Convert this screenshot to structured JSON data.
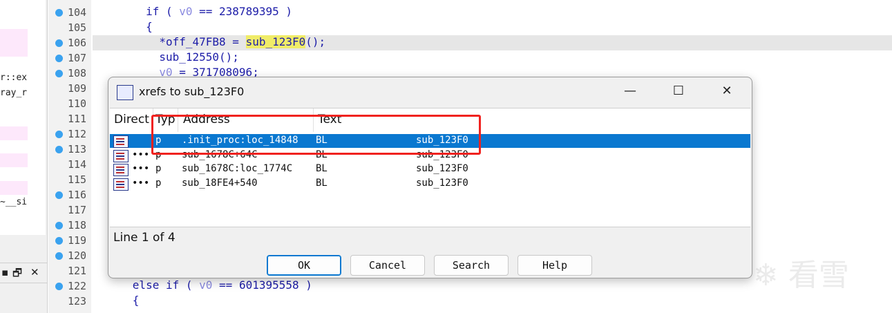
{
  "left_pane": {
    "text_1": "r::ex",
    "text_2": "ray_r",
    "text_3": "~__si"
  },
  "code": {
    "lines": [
      {
        "n": "104",
        "dot": true,
        "html": "        <span class='tok-kw'>if</span> ( <span class='tok-var'>v0</span> == 238789395 )"
      },
      {
        "n": "105",
        "dot": false,
        "html": "        {"
      },
      {
        "n": "106",
        "dot": true,
        "hl": true,
        "html": "          *off_47FB8 = <span class='tok-yel'>sub_123F0</span>();"
      },
      {
        "n": "107",
        "dot": true,
        "html": "          sub_12550();"
      },
      {
        "n": "108",
        "dot": true,
        "html": "          <span class='tok-var'>v0</span> = 371708096;"
      },
      {
        "n": "109",
        "dot": false,
        "html": ""
      },
      {
        "n": "110",
        "dot": false,
        "html": ""
      },
      {
        "n": "111",
        "dot": false,
        "html": ""
      },
      {
        "n": "112",
        "dot": true,
        "html": ""
      },
      {
        "n": "113",
        "dot": true,
        "html": ""
      },
      {
        "n": "114",
        "dot": false,
        "html": ""
      },
      {
        "n": "115",
        "dot": false,
        "html": ""
      },
      {
        "n": "116",
        "dot": true,
        "html": ""
      },
      {
        "n": "117",
        "dot": false,
        "html": ""
      },
      {
        "n": "118",
        "dot": true,
        "html": ""
      },
      {
        "n": "119",
        "dot": true,
        "html": ""
      },
      {
        "n": "120",
        "dot": true,
        "html": ""
      },
      {
        "n": "121",
        "dot": false,
        "html": ""
      },
      {
        "n": "122",
        "dot": true,
        "html": "      <span class='tok-kw'>else if</span> ( <span class='tok-var'>v0</span> == 601395558 )"
      },
      {
        "n": "123",
        "dot": false,
        "html": "      {"
      }
    ]
  },
  "dialog": {
    "title": "xrefs to sub_123F0",
    "minimize": "—",
    "maximize": "☐",
    "close": "✕",
    "columns": {
      "direction": "Direct",
      "type": "Typ",
      "address": "Address",
      "text": "Text"
    },
    "rows": [
      {
        "dir": "",
        "type": "p",
        "address": ".init_proc:loc_14848",
        "mnemonic": "BL",
        "operand": "sub_123F0",
        "selected": true
      },
      {
        "dir": "•••",
        "type": "p",
        "address": "sub_1678C+64C",
        "mnemonic": "BL",
        "operand": "sub_123F0",
        "selected": false
      },
      {
        "dir": "•••",
        "type": "p",
        "address": "sub_1678C:loc_1774C",
        "mnemonic": "BL",
        "operand": "sub_123F0",
        "selected": false
      },
      {
        "dir": "•••",
        "type": "p",
        "address": "sub_18FE4+540",
        "mnemonic": "BL",
        "operand": "sub_123F0",
        "selected": false
      }
    ],
    "status": "Line 1 of 4",
    "buttons": {
      "ok": "OK",
      "cancel": "Cancel",
      "search": "Search",
      "help": "Help"
    }
  },
  "watermark": "❄ 看雪",
  "colors": {
    "selection": "#0a78d0",
    "highlight_box": "#f0221f",
    "breakpoint_dot": "#3aa2ef",
    "symbol_highlight": "#f0ec68"
  }
}
